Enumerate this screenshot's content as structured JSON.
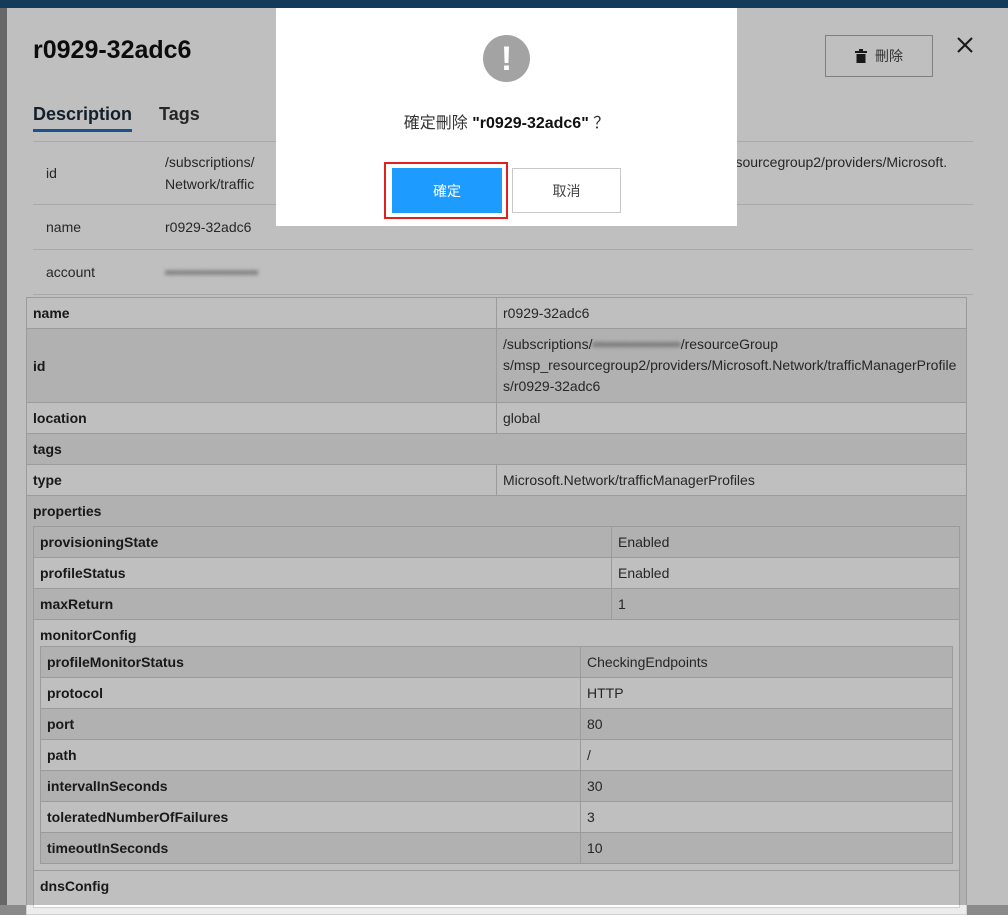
{
  "panel": {
    "title": "r0929-32adc6",
    "delete_label": "刪除",
    "tabs": [
      "Description",
      "Tags"
    ]
  },
  "description": [
    {
      "label": "id",
      "value": "/subscriptions/",
      "value_right": "resourcegroup2/providers/Microsoft.",
      "value_line2": "Network/traffic"
    },
    {
      "label": "name",
      "value": "r0929-32adc6"
    },
    {
      "label": "account",
      "value": "•••••••••••••••••••"
    }
  ],
  "resource": {
    "name_key": "name",
    "name_val": "r0929-32adc6",
    "id_key": "id",
    "id_val_line1_prefix": "/subscriptions/",
    "id_val_line1_blur": "••••••••••••••••••",
    "id_val_line1_suffix": "/resourceGroup",
    "id_val_line2": "s/msp_resourcegroup2/providers/Microsoft.Network/trafficManagerProfile",
    "id_val_line3": "s/r0929-32adc6",
    "location_key": "location",
    "location_val": "global",
    "tags_key": "tags",
    "type_key": "type",
    "type_val": "Microsoft.Network/trafficManagerProfiles",
    "properties_key": "properties"
  },
  "properties": [
    {
      "k": "provisioningState",
      "v": "Enabled"
    },
    {
      "k": "profileStatus",
      "v": "Enabled"
    },
    {
      "k": "maxReturn",
      "v": "1"
    }
  ],
  "monitorConfig": {
    "title": "monitorConfig",
    "rows": [
      {
        "k": "profileMonitorStatus",
        "v": "CheckingEndpoints"
      },
      {
        "k": "protocol",
        "v": "HTTP"
      },
      {
        "k": "port",
        "v": "80"
      },
      {
        "k": "path",
        "v": "/"
      },
      {
        "k": "intervalInSeconds",
        "v": "30"
      },
      {
        "k": "toleratedNumberOfFailures",
        "v": "3"
      },
      {
        "k": "timeoutInSeconds",
        "v": "10"
      }
    ]
  },
  "dnsConfig": {
    "title": "dnsConfig"
  },
  "dialog": {
    "icon": "!",
    "text_prefix": "確定刪除",
    "text_target": "\"r0929-32adc6\"",
    "text_suffix": "？",
    "ok_label": "確定",
    "cancel_label": "取消"
  }
}
